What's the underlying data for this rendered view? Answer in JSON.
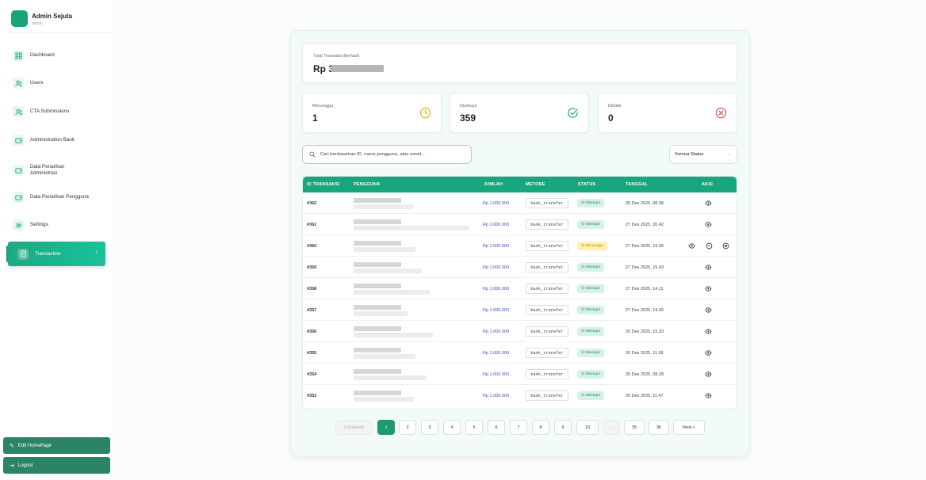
{
  "sidebar": {
    "brand_name": "Admin Sejuta",
    "brand_role": "admin",
    "items": [
      {
        "label": "Dashboard",
        "icon": "grid-icon"
      },
      {
        "label": "Users",
        "icon": "users-icon"
      },
      {
        "label": "CTA Submissions",
        "icon": "users-icon"
      },
      {
        "label": "Administration Bank",
        "icon": "wallet-icon"
      },
      {
        "label": "Data Penarikan Administrasi",
        "icon": "wallet-icon"
      },
      {
        "label": "Data Penarikan Pengguna",
        "icon": "wallet-icon"
      },
      {
        "label": "Settings",
        "icon": "gear-icon"
      },
      {
        "label": "Transaction",
        "icon": "receipt-icon",
        "active": true
      }
    ],
    "edit_homepage_label": "Edit HomePage",
    "logout_label": "Logout"
  },
  "summary": {
    "total_label": "Total Transaksi Berhasil",
    "total_value_prefix": "Rp 3",
    "stats": [
      {
        "label": "Menunggu",
        "value": "1",
        "color": "#e6b020",
        "icon": "clock-icon"
      },
      {
        "label": "Disetujui",
        "value": "359",
        "color": "#1fa67a",
        "icon": "check-circle-icon"
      },
      {
        "label": "Ditolak",
        "value": "0",
        "color": "#e05a5a",
        "icon": "x-circle-icon"
      }
    ]
  },
  "filters": {
    "search_placeholder": "Cari berdasarkan ID, nama pengguna, atau email...",
    "status_select": "Semua Status"
  },
  "table": {
    "headers": [
      "ID TRANSAKSI",
      "PENGGUNA",
      "JUMLAH",
      "METODE",
      "STATUS",
      "TANGGAL",
      "AKSI"
    ],
    "rows": [
      {
        "id": "#362",
        "amount": "Rp 1.000.000",
        "method": "bank_transfer",
        "status": "Disetujui",
        "date": "28 Des 2025, 08.38"
      },
      {
        "id": "#361",
        "amount": "Rp 1.000.000",
        "method": "bank_transfer",
        "status": "Disetujui",
        "date": "27 Des 2025, 20.42"
      },
      {
        "id": "#360",
        "amount": "Rp 1.000.000",
        "method": "bank_transfer",
        "status": "Menunggu",
        "date": "27 Des 2025, 19.06"
      },
      {
        "id": "#359",
        "amount": "Rp 1.000.000",
        "method": "bank_transfer",
        "status": "Disetujui",
        "date": "27 Des 2025, 15.43"
      },
      {
        "id": "#358",
        "amount": "Rp 1.000.000",
        "method": "bank_transfer",
        "status": "Disetujui",
        "date": "27 Des 2025, 14.11"
      },
      {
        "id": "#357",
        "amount": "Rp 1.000.000",
        "method": "bank_transfer",
        "status": "Disetujui",
        "date": "27 Des 2025, 14.09"
      },
      {
        "id": "#356",
        "amount": "Rp 1.000.000",
        "method": "bank_transfer",
        "status": "Disetujui",
        "date": "26 Des 2025, 15.33"
      },
      {
        "id": "#355",
        "amount": "Rp 1.000.000",
        "method": "bank_transfer",
        "status": "Disetujui",
        "date": "26 Des 2025, 11.59"
      },
      {
        "id": "#354",
        "amount": "Rp 1.000.000",
        "method": "bank_transfer",
        "status": "Disetujui",
        "date": "26 Des 2025, 08.28"
      },
      {
        "id": "#353",
        "amount": "Rp 1.000.000",
        "method": "bank_transfer",
        "status": "Disetujui",
        "date": "25 Des 2025, 11.47"
      }
    ]
  },
  "pagination": {
    "previous_label": "« Previous",
    "pages": [
      "1",
      "2",
      "3",
      "4",
      "5",
      "6",
      "7",
      "8",
      "9",
      "10",
      "...",
      "35",
      "36"
    ],
    "current": "1",
    "next_label": "Next »"
  },
  "colors": {
    "accent": "#17a67d",
    "active_page": "#1a9b72",
    "sidebar_button": "#2d8465"
  }
}
